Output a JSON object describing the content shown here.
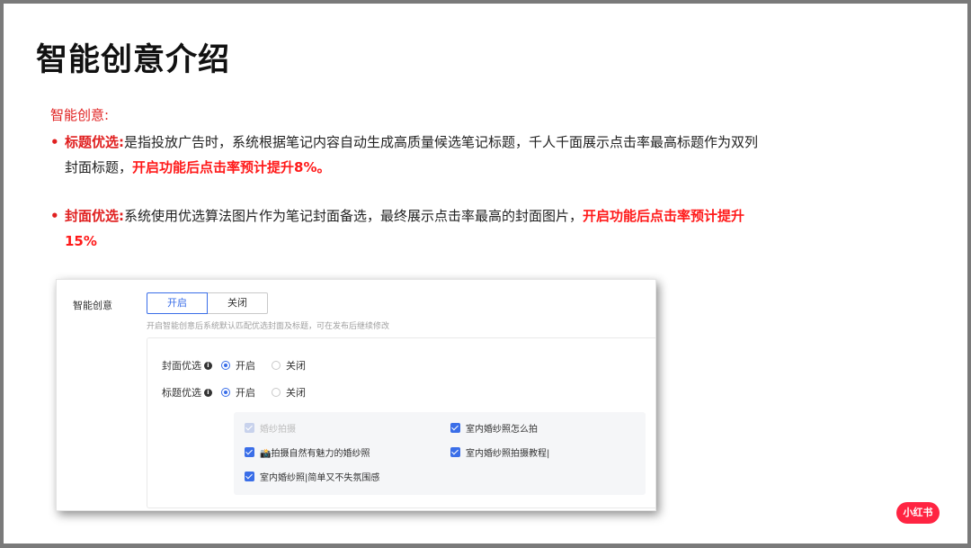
{
  "slide": {
    "title": "智能创意介绍",
    "intro": "智能创意:",
    "bullets": [
      {
        "lead": "标题优选:",
        "text": "是指投放广告时，系统根据笔记内容自动生成高质量候选笔记标题，千人千面展示点击率最高标题作为双列封面标题，",
        "highlight": "开启功能后点击率预计提升8%。"
      },
      {
        "lead": "封面优选:",
        "text": "系统使用优选算法图片作为笔记封面备选，最终展示点击率最高的封面图片，",
        "highlight": "开启功能后点击率预计提升15%"
      }
    ]
  },
  "screenshot": {
    "label": "智能创意",
    "toggle": {
      "on_label": "开启",
      "off_label": "关闭",
      "selected": "on"
    },
    "hint": "开启智能创意后系统默认匹配优选封面及标题，可在发布后继续修改",
    "cover_option": {
      "label": "封面优选",
      "on_label": "开启",
      "off_label": "关闭",
      "selected": "on"
    },
    "title_option": {
      "label": "标题优选",
      "on_label": "开启",
      "off_label": "关闭",
      "selected": "on"
    },
    "candidates": [
      {
        "text": "婚纱拍摄",
        "checked": true,
        "disabled": true
      },
      {
        "text": "室内婚纱照怎么拍",
        "checked": true,
        "disabled": false
      },
      {
        "text": "📸拍摄自然有魅力的婚纱照",
        "checked": true,
        "disabled": false
      },
      {
        "text": "室内婚纱照拍摄教程|",
        "checked": true,
        "disabled": false
      },
      {
        "text": "室内婚纱照|简单又不失氛围感",
        "checked": true,
        "disabled": false
      }
    ]
  },
  "brand": {
    "logo_text": "小红书",
    "color": "#ff2442"
  },
  "colors": {
    "accent_red": "#e02020",
    "accent_blue": "#3a6ee8"
  },
  "icons": [
    "info-icon",
    "radio-icon",
    "checkbox-icon"
  ]
}
